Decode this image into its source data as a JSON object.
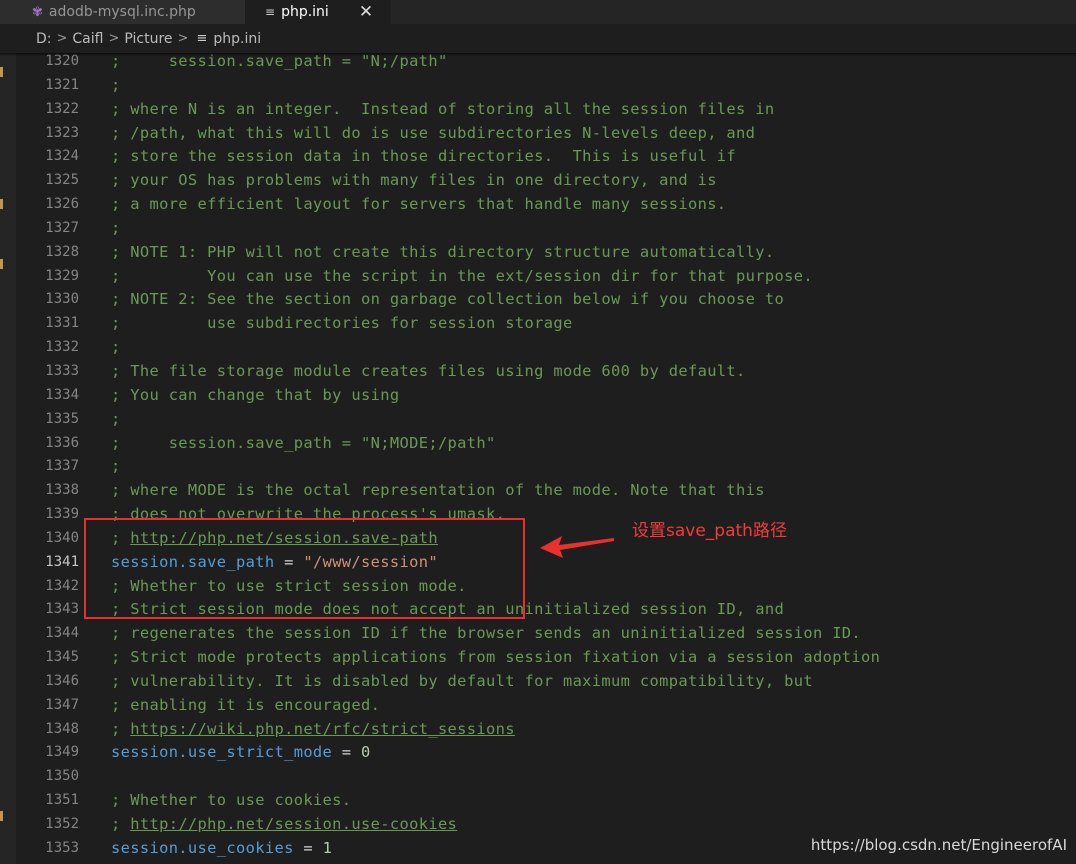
{
  "tabs": [
    {
      "label": "adodb-mysql.inc.php",
      "icon": "php-file-icon"
    },
    {
      "label": "php.ini",
      "icon": "settings-file-icon",
      "close": "✕"
    }
  ],
  "breadcrumb": {
    "items": [
      "D:",
      "Caifl",
      "Picture"
    ],
    "file": "php.ini"
  },
  "editor": {
    "current_line": 1341,
    "lines": [
      {
        "n": "1320",
        "t": [
          [
            "c",
            ";     session.save_path = \"N;/path\""
          ]
        ]
      },
      {
        "n": "1321",
        "t": [
          [
            "c",
            ";"
          ]
        ]
      },
      {
        "n": "1322",
        "t": [
          [
            "c",
            "; where N is an integer.  Instead of storing all the session files in"
          ]
        ]
      },
      {
        "n": "1323",
        "t": [
          [
            "c",
            "; /path, what this will do is use subdirectories N-levels deep, and"
          ]
        ]
      },
      {
        "n": "1324",
        "t": [
          [
            "c",
            "; store the session data in those directories.  This is useful if"
          ]
        ]
      },
      {
        "n": "1325",
        "t": [
          [
            "c",
            "; your OS has problems with many files in one directory, and is"
          ]
        ]
      },
      {
        "n": "1326",
        "t": [
          [
            "c",
            "; a more efficient layout for servers that handle many sessions."
          ]
        ]
      },
      {
        "n": "1327",
        "t": [
          [
            "c",
            ";"
          ]
        ]
      },
      {
        "n": "1328",
        "t": [
          [
            "c",
            "; NOTE 1: PHP will not create this directory structure automatically."
          ]
        ]
      },
      {
        "n": "1329",
        "t": [
          [
            "c",
            ";         You can use the script in the ext/session dir for that purpose."
          ]
        ]
      },
      {
        "n": "1330",
        "t": [
          [
            "c",
            "; NOTE 2: See the section on garbage collection below if you choose to"
          ]
        ]
      },
      {
        "n": "1331",
        "t": [
          [
            "c",
            ";         use subdirectories for session storage"
          ]
        ]
      },
      {
        "n": "1332",
        "t": [
          [
            "c",
            ";"
          ]
        ]
      },
      {
        "n": "1333",
        "t": [
          [
            "c",
            "; The file storage module creates files using mode 600 by default."
          ]
        ]
      },
      {
        "n": "1334",
        "t": [
          [
            "c",
            "; You can change that by using"
          ]
        ]
      },
      {
        "n": "1335",
        "t": [
          [
            "c",
            ";"
          ]
        ]
      },
      {
        "n": "1336",
        "t": [
          [
            "c",
            ";     session.save_path = \"N;MODE;/path\""
          ]
        ]
      },
      {
        "n": "1337",
        "t": [
          [
            "c",
            ";"
          ]
        ]
      },
      {
        "n": "1338",
        "t": [
          [
            "c",
            "; where MODE is the octal representation of the mode. Note that this"
          ]
        ]
      },
      {
        "n": "1339",
        "t": [
          [
            "c",
            "; does not overwrite the process's umask."
          ]
        ]
      },
      {
        "n": "1340",
        "t": [
          [
            "c",
            "; "
          ],
          [
            "link",
            "http://php.net/session.save-path"
          ]
        ]
      },
      {
        "n": "1341",
        "t": [
          [
            "key",
            "session.save_path"
          ],
          [
            "op",
            " = "
          ],
          [
            "str",
            "\"/www/session\""
          ]
        ]
      },
      {
        "n": "1342",
        "t": [
          [
            "c",
            "; Whether to use strict session mode."
          ]
        ]
      },
      {
        "n": "1343",
        "t": [
          [
            "c",
            "; Strict session mode does not accept an uninitialized session ID, and"
          ]
        ]
      },
      {
        "n": "1344",
        "t": [
          [
            "c",
            "; regenerates the session ID if the browser sends an uninitialized session ID."
          ]
        ]
      },
      {
        "n": "1345",
        "t": [
          [
            "c",
            "; Strict mode protects applications from session fixation via a session adoption"
          ]
        ]
      },
      {
        "n": "1346",
        "t": [
          [
            "c",
            "; vulnerability. It is disabled by default for maximum compatibility, but"
          ]
        ]
      },
      {
        "n": "1347",
        "t": [
          [
            "c",
            "; enabling it is encouraged."
          ]
        ]
      },
      {
        "n": "1348",
        "t": [
          [
            "c",
            "; "
          ],
          [
            "link",
            "https://wiki.php.net/rfc/strict_sessions"
          ]
        ]
      },
      {
        "n": "1349",
        "t": [
          [
            "key",
            "session.use_strict_mode"
          ],
          [
            "op",
            " = "
          ],
          [
            "num",
            "0"
          ]
        ]
      },
      {
        "n": "1350",
        "t": []
      },
      {
        "n": "1351",
        "t": [
          [
            "c",
            "; Whether to use cookies."
          ]
        ]
      },
      {
        "n": "1352",
        "t": [
          [
            "c",
            "; "
          ],
          [
            "link",
            "http://php.net/session.use-cookies"
          ]
        ]
      },
      {
        "n": "1353",
        "t": [
          [
            "key",
            "session.use_cookies"
          ],
          [
            "op",
            " = "
          ],
          [
            "num",
            "1"
          ]
        ]
      }
    ]
  },
  "annotation": {
    "text": "设置save_path路径",
    "color": "#f03c3c"
  },
  "watermark": "https://blog.csdn.net/EngineerofAI",
  "colors": {
    "comment": "#6a9955",
    "key": "#569cd6",
    "string": "#ce9178",
    "number": "#b5cea8",
    "background": "#1e1e1e"
  }
}
